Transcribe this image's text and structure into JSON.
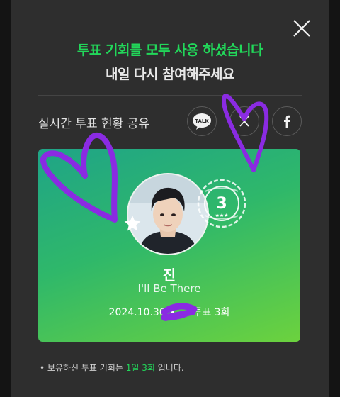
{
  "header": {
    "headline": "투표 기회를 모두 사용 하셨습니다",
    "subline": "내일 다시 참여해주세요"
  },
  "share": {
    "label": "실시간 투표 현황 공유",
    "kakao_label": "TALK",
    "buttons": [
      "kakao-icon",
      "x-icon",
      "facebook-icon"
    ]
  },
  "card": {
    "artist": "진",
    "song": "I'll Be There",
    "date": "2024.10.30",
    "dot": "•",
    "vote_suffix": "투표 3회",
    "stamp_number": "3"
  },
  "note": {
    "bullet": "•",
    "prefix": "보유하신 투표 기회는",
    "highlight": "1일 3회",
    "suffix": "입니다."
  },
  "colors": {
    "accent": "#22d75a",
    "card_start": "#1fa487",
    "card_end": "#6cd23e",
    "scribble": "#8a2be2"
  }
}
